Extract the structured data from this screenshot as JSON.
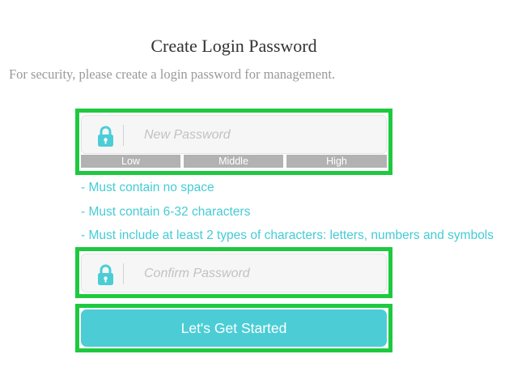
{
  "page": {
    "title": "Create Login Password",
    "subtitle": "For security, please create a login password for management."
  },
  "new_password": {
    "placeholder": "New Password",
    "value": ""
  },
  "strength": {
    "levels": [
      "Low",
      "Middle",
      "High"
    ]
  },
  "rules": [
    "- Must contain no space",
    "- Must contain 6-32 characters",
    "- Must include at least 2 types of characters: letters, numbers and symbols"
  ],
  "confirm_password": {
    "placeholder": "Confirm Password",
    "value": ""
  },
  "submit": {
    "label": "Let's Get Started"
  },
  "colors": {
    "accent": "#4ccdd6",
    "highlight": "#1ec93f",
    "strength_bar": "#b2b2b2",
    "rule_text": "#45cbd5"
  },
  "icons": {
    "password_field": "lock-icon",
    "confirm_field": "lock-icon"
  }
}
